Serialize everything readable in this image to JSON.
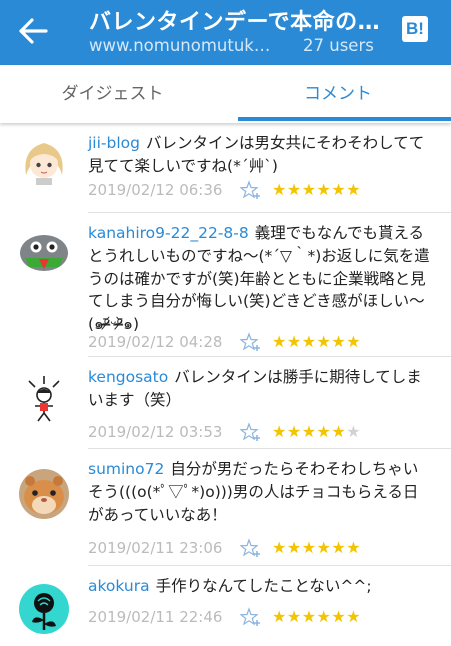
{
  "appbar": {
    "title": "バレンタインデーで本命の…",
    "site": "www.nomunomutuk…",
    "users": "27 users",
    "hatena_logo": "B!",
    "color": "#2a8ad6"
  },
  "tabs": [
    {
      "label": "ダイジェスト",
      "active": false
    },
    {
      "label": "コメント",
      "active": true
    }
  ],
  "comments": [
    {
      "user": "jii-blog",
      "text": "バレンタインは男女共にそわそわしてて 見てて楽しいですね(*´艸`)",
      "date": "2019/02/12 06:36",
      "stars": 6,
      "avatar_icon": "anime-girl-icon"
    },
    {
      "user": "kanahiro9-22_22-8-8",
      "text": "義理でもなんでも貰えるとうれしいものですね～(*´▽｀*)お返しに気を遣うのは確かですが(笑)年齢とともに企業戦略と見てしまう自分が悔しい(笑)どきどき感がほしい～(๑ᵒ̴̶̷᷄ᵕᵒ̴̶̷᷅๑)",
      "date": "2019/02/12 04:28",
      "stars": 6,
      "avatar_icon": "robot-face-icon"
    },
    {
      "user": "kengosato",
      "text": "バレンタインは勝手に期待してしまいます（笑）",
      "date": "2019/02/12 03:53",
      "stars": 5,
      "avatar_icon": "doodle-person-icon"
    },
    {
      "user": "sumino72",
      "text": "自分が男だったらそわそわしちゃいそう(((o(*ﾟ▽ﾟ*)o)))男の人はチョコもらえる日があっていいなあ！",
      "date": "2019/02/11 23:06",
      "stars": 6,
      "avatar_icon": "hamster-photo-icon"
    },
    {
      "user": "akokura",
      "text": "手作りなんてしたことない^^;",
      "date": "2019/02/11 22:46",
      "stars": 6,
      "avatar_icon": "black-rose-icon"
    }
  ],
  "star_symbol": "★",
  "colors": {
    "star_on": "#f3c400",
    "star_off": "#d2d2d2",
    "user": "#2a8ad6",
    "date": "#bbbbbb"
  }
}
